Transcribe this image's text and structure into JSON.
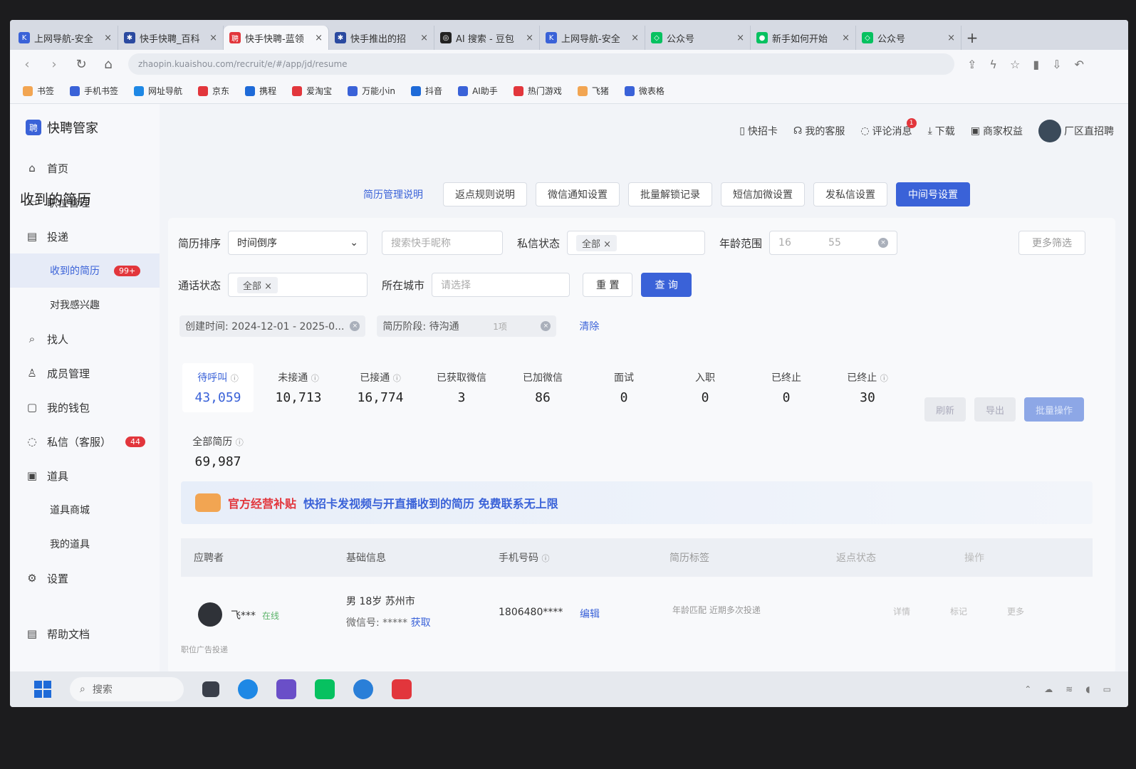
{
  "browser": {
    "tabs": [
      {
        "label": "上网导航-安全",
        "color": "#3a62d8"
      },
      {
        "label": "快手快聘_百科",
        "color": "#2b4aa0"
      },
      {
        "label": "快手快聘-蓝领",
        "color": "#e2363c",
        "active": true
      },
      {
        "label": "快手推出的招",
        "color": "#2b4aa0"
      },
      {
        "label": "AI 搜索 - 豆包",
        "color": "#222"
      },
      {
        "label": "上网导航-安全",
        "color": "#3a62d8"
      },
      {
        "label": "公众号",
        "color": "#07c160"
      },
      {
        "label": "新手如何开始",
        "color": "#07c160"
      },
      {
        "label": "公众号",
        "color": "#07c160"
      }
    ],
    "new_tab": "+",
    "address": "zhaopin.kuaishou.com/recruit/e/#/app/jd/resume"
  },
  "bookmarks": [
    {
      "label": "书签",
      "color": "#f2a552"
    },
    {
      "label": "手机书签",
      "color": "#3a62d8"
    },
    {
      "label": "网址导航",
      "color": "#1e88e5"
    },
    {
      "label": "京东",
      "color": "#e2363c"
    },
    {
      "label": "携程",
      "color": "#1e6ad8"
    },
    {
      "label": "爱淘宝",
      "color": "#e2363c"
    },
    {
      "label": "万能小in",
      "color": "#3a62d8"
    },
    {
      "label": "抖音",
      "color": "#1e6ad8"
    },
    {
      "label": "AI助手",
      "color": "#3a62d8"
    },
    {
      "label": "热门游戏",
      "color": "#e2363c"
    },
    {
      "label": "飞猪",
      "color": "#f2a552"
    },
    {
      "label": "微表格",
      "color": "#3a62d8"
    }
  ],
  "app": {
    "name": "快聘管家",
    "logo": "聘"
  },
  "sidebar": {
    "items": [
      {
        "label": "首页",
        "icon": "⌂"
      },
      {
        "label": "职位管理",
        "icon": "▭"
      },
      {
        "label": "投递",
        "icon": "▤"
      },
      {
        "label": "收到的简历",
        "sub": true,
        "active": true,
        "badge": "99+"
      },
      {
        "label": "对我感兴趣",
        "sub": true
      },
      {
        "label": "找人",
        "icon": "⌕"
      },
      {
        "label": "成员管理",
        "icon": "♙"
      },
      {
        "label": "我的钱包",
        "icon": "▢"
      },
      {
        "label": "私信（客服）",
        "icon": "◌",
        "badge": "44"
      },
      {
        "label": "道具",
        "icon": "▣"
      },
      {
        "label": "道具商城",
        "sub": true
      },
      {
        "label": "我的道具",
        "sub": true
      },
      {
        "label": "设置",
        "icon": "⚙"
      }
    ],
    "help": "帮助文档"
  },
  "userbar": {
    "items": [
      "快招卡",
      "我的客服",
      "评论消息",
      "下载",
      "商家权益"
    ],
    "comment_badge": "1",
    "user": "厂区直招聘"
  },
  "page": {
    "title": "收到的简历",
    "link": "简历管理说明",
    "buttons": [
      "返点规则说明",
      "微信通知设置",
      "批量解锁记录",
      "短信加微设置",
      "发私信设置"
    ],
    "primary_button": "中间号设置"
  },
  "filters": {
    "sort_label": "简历排序",
    "sort_value": "时间倒序",
    "search_placeholder": "搜索快手昵称",
    "msg_status_label": "私信状态",
    "msg_status_value": "全部",
    "age_label": "年龄范围",
    "age_min": "16",
    "age_max": "55",
    "more": "更多筛选",
    "call_status_label": "通话状态",
    "call_status_value": "全部",
    "city_label": "所在城市",
    "city_placeholder": "请选择",
    "reset": "重 置",
    "query": "查 询",
    "chip_created": "创建时间: 2024-12-01 - 2025-0...",
    "chip_stage": "简历阶段: 待沟通",
    "chip_stage_count": "1项",
    "clear": "清除"
  },
  "stats": [
    {
      "label": "待呼叫",
      "value": "43,059",
      "active": true,
      "info": true
    },
    {
      "label": "未接通",
      "value": "10,713",
      "info": true
    },
    {
      "label": "已接通",
      "value": "16,774",
      "info": true
    },
    {
      "label": "已获取微信",
      "value": "3"
    },
    {
      "label": "已加微信",
      "value": "86"
    },
    {
      "label": "面试",
      "value": "0"
    },
    {
      "label": "入职",
      "value": "0"
    },
    {
      "label": "已终止",
      "value": "0"
    },
    {
      "label": "已终止",
      "value": "30",
      "info": true
    }
  ],
  "total": {
    "label": "全部简历",
    "value": "69,987"
  },
  "batch_buttons": [
    "刷新",
    "导出",
    "批量操作"
  ],
  "banner": {
    "red": "官方经营补贴",
    "blue": "快招卡发视频与开直播收到的简历 免费联系无上限"
  },
  "table": {
    "headers": [
      "应聘者",
      "基础信息",
      "手机号码",
      "简历标签",
      "返点状态",
      "操作"
    ],
    "rows": [
      {
        "name": "飞***",
        "online": "在线",
        "basic": "男 18岁 苏州市",
        "wechat_label": "微信号: *****",
        "wechat_action": "获取",
        "phone": "1806480****",
        "edit": "编辑",
        "tags": "年龄匹配  近期多次投递",
        "actions": [
          "详情",
          "标记",
          "更多"
        ]
      }
    ],
    "footer_text": "职位广告投递"
  },
  "taskbar": {
    "search": "搜索"
  }
}
